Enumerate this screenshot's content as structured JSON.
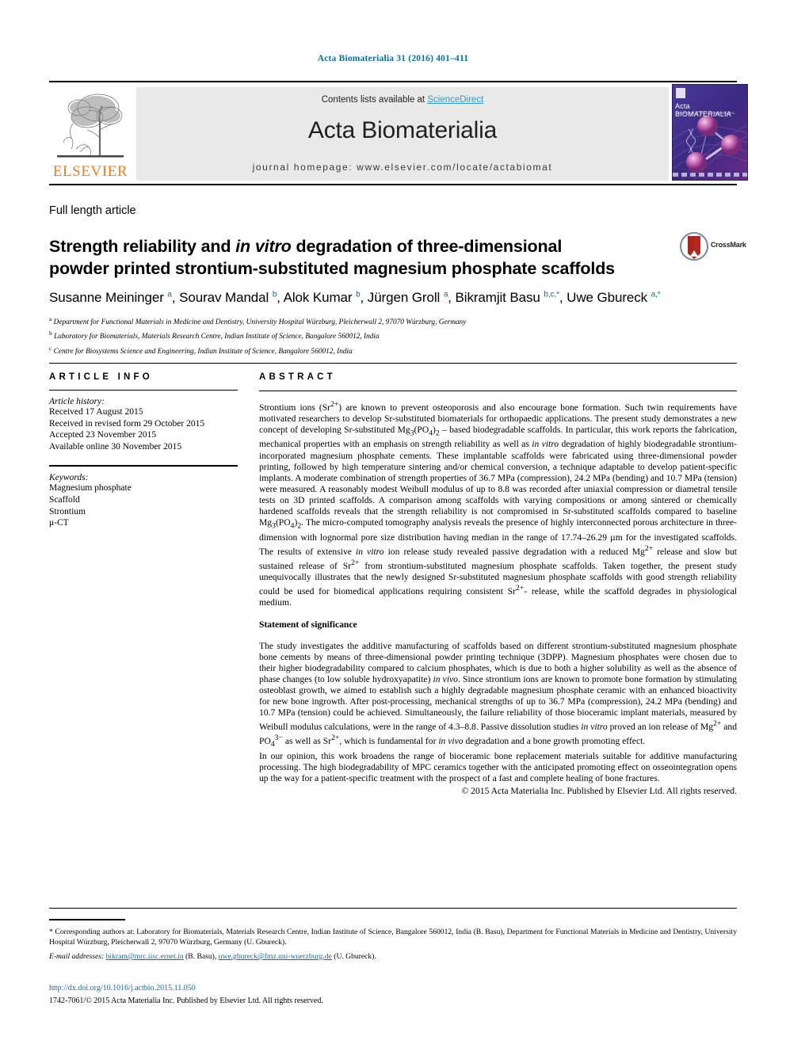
{
  "running_head": "Acta Biomaterialia 31 (2016) 401–411",
  "masthead": {
    "publisher_logo_name": "ELSEVIER",
    "contents_prefix": "Contents lists available at ",
    "contents_link": "ScienceDirect",
    "journal_name": "Acta Biomaterialia",
    "homepage": "journal homepage: www.elsevier.com/locate/actabiomat",
    "cover_title": "Acta BIOMATERIALIA",
    "cover_subtitle": "The Journal of The Acta Materialia Inc.",
    "link_color": "#2e9bd6",
    "elsevier_orange": "#ef7d1a",
    "panel_grey": "#e9e9e9"
  },
  "article": {
    "type": "Full length article",
    "title_line1_a": "Strength reliability and ",
    "title_line1_em": "in vitro",
    "title_line1_b": " degradation of three-dimensional",
    "title_line2": "powder printed strontium-substituted magnesium phosphate scaffolds",
    "crossmark_label": "CrossMark",
    "authors": "Susanne Meininger a, Sourav Mandal b, Alok Kumar b, Jürgen Groll a, Bikramjit Basu b,c,*, Uwe Gbureck a,*",
    "affiliations": [
      "a Department for Functional Materials in Medicine and Dentistry, University Hospital Würzburg, Pleicherwall 2, 97070 Würzburg, Germany",
      "b Laboratory for Biomaterials, Materials Research Centre, Indian Institute of Science, Bangalore 560012, India",
      "c Centre for Biosystems Science and Engineering, Indian Institute of Science, Bangalore 560012, India"
    ]
  },
  "info": {
    "heading": "ARTICLE INFO",
    "history_label": "Article history:",
    "history": [
      "Received 17 August 2015",
      "Received in revised form 29 October 2015",
      "Accepted 23 November 2015",
      "Available online 30 November 2015"
    ],
    "keywords_label": "Keywords:",
    "keywords": [
      "Magnesium phosphate",
      "Scaffold",
      "Strontium",
      "μ-CT"
    ]
  },
  "abstract": {
    "heading": "ABSTRACT",
    "paragraph_1": "Strontium ions (Sr2+) are known to prevent osteoporosis and also encourage bone formation. Such twin requirements have motivated researchers to develop Sr-substituted biomaterials for orthopaedic applications. The present study demonstrates a new concept of developing Sr-substituted Mg3(PO4)2 – based biodegradable scaffolds. In particular, this work reports the fabrication, mechanical properties with an emphasis on strength reliability as well as in vitro degradation of highly biodegradable strontium-incorporated magnesium phosphate cements. These implantable scaffolds were fabricated using three-dimensional powder printing, followed by high temperature sintering and/or chemical conversion, a technique adaptable to develop patient-specific implants. A moderate combination of strength properties of 36.7 MPa (compression), 24.2 MPa (bending) and 10.7 MPa (tension) were measured. A reasonably modest Weibull modulus of up to 8.8 was recorded after uniaxial compression or diametral tensile tests on 3D printed scaffolds. A comparison among scaffolds with varying compositions or among sintered or chemically hardened scaffolds reveals that the strength reliability is not compromised in Sr-substituted scaffolds compared to baseline Mg3(PO4)2. The micro-computed tomography analysis reveals the presence of highly interconnected porous architecture in three-dimension with lognormal pore size distribution having median in the range of 17.74–26.29 μm for the investigated scaffolds. The results of extensive in vitro ion release study revealed passive degradation with a reduced Mg2+ release and slow but sustained release of Sr2+ from strontium-substituted magnesium phosphate scaffolds. Taken together, the present study unequivocally illustrates that the newly designed Sr-substituted magnesium phosphate scaffolds with good strength reliability could be used for biomedical applications requiring consistent Sr2+ - release, while the scaffold degrades in physiological medium.",
    "statement_heading": "Statement of significance",
    "paragraph_2": "The study investigates the additive manufacturing of scaffolds based on different strontium-substituted magnesium phosphate bone cements by means of three-dimensional powder printing technique (3DPP). Magnesium phosphates were chosen due to their higher biodegradability compared to calcium phosphates, which is due to both a higher solubility as well as the absence of phase changes (to low soluble hydroxyapatite) in vivo. Since strontium ions are known to promote bone formation by stimulating osteoblast growth, we aimed to establish such a highly degradable magnesium phosphate ceramic with an enhanced bioactivity for new bone ingrowth. After post-processing, mechanical strengths of up to 36.7 MPa (compression), 24.2 MPa (bending) and 10.7 MPa (tension) could be achieved. Simultaneously, the failure reliability of those bioceramic implant materials, measured by Weibull modulus calculations, were in the range of 4.3–8.8. Passive dissolution studies in vitro proved an ion release of Mg2+ and PO43- as well as Sr2+, which is fundamental for in vivo degradation and a bone growth promoting effect.",
    "paragraph_3": "In our opinion, this work broadens the range of bioceramic bone replacement materials suitable for additive manufacturing processing. The high biodegradability of MPC ceramics together with the anticipated promoting effect on osseointegration opens up the way for a patient-specific treatment with the prospect of a fast and complete healing of bone fractures.",
    "copyright": "© 2015 Acta Materialia Inc. Published by Elsevier Ltd. All rights reserved."
  },
  "footer": {
    "corresponding": "* Corresponding authors at: Laboratory for Biomaterials, Materials Research Centre, Indian Institute of Science, Bangalore 560012, India (B. Basu), Department for Functional Materials in Medicine and Dentistry, University Hospital Würzburg, Pleicherwall 2, 97070 Würzburg, Germany (U. Gbureck).",
    "email_label": "E-mail addresses:",
    "email_1": "bikram@mrc.iisc.ernet.in",
    "email_1_suffix": " (B. Basu), ",
    "email_2": "uwe.gbureck@fmz.uni-wuerzburg.de",
    "email_2_suffix": " (U. Gbureck).",
    "doi": "http://dx.doi.org/10.1016/j.actbio.2015.11.050",
    "issn": "1742-7061/© 2015 Acta Materialia Inc. Published by Elsevier Ltd. All rights reserved."
  }
}
